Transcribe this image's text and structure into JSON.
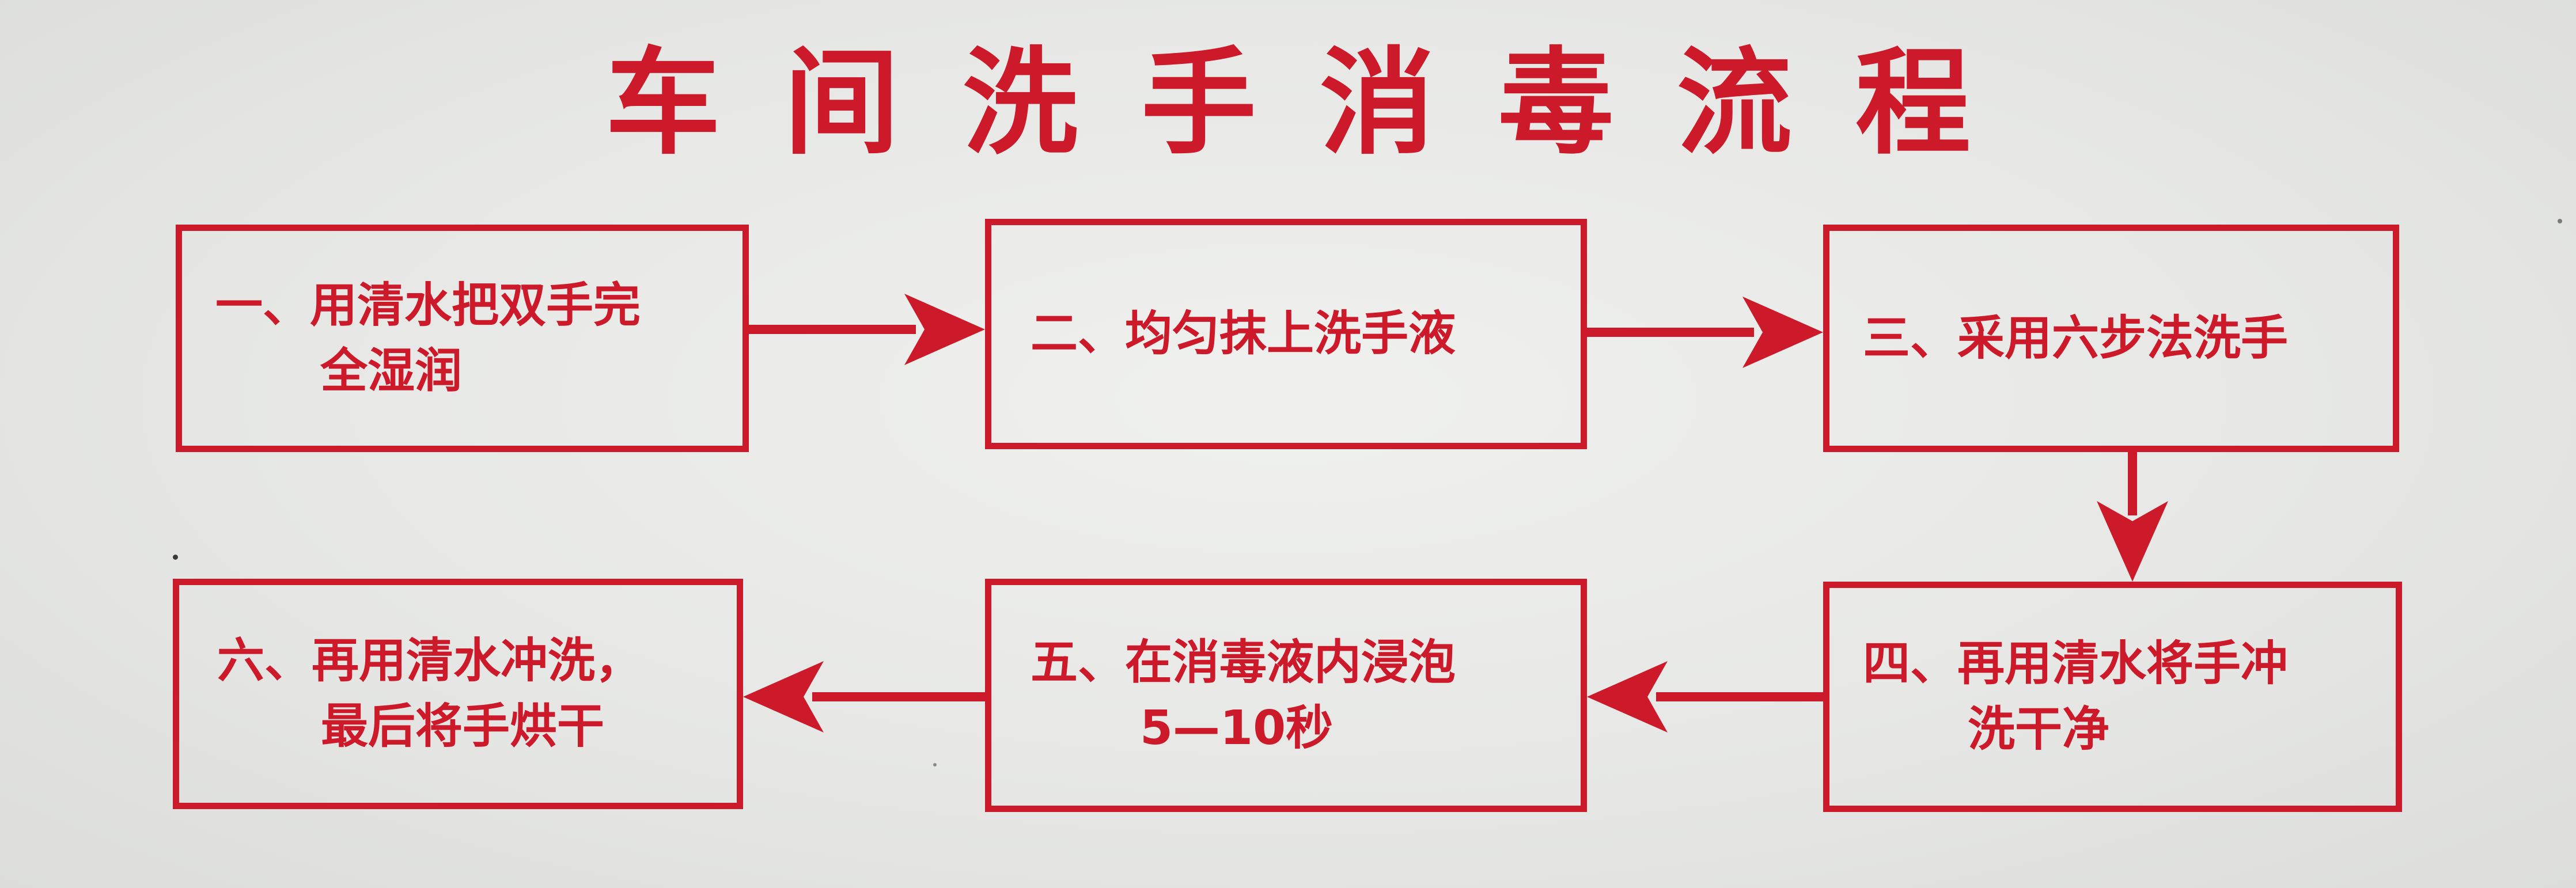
{
  "title": "车间洗手消毒流程",
  "steps": [
    {
      "line1": "一、用清水把双手完",
      "line2": "全湿润"
    },
    {
      "line1": "二、均匀抹上洗手液",
      "line2": ""
    },
    {
      "line1": "三、采用六步法洗手",
      "line2": ""
    },
    {
      "line1": "四、再用清水将手冲",
      "line2": "洗干净"
    },
    {
      "line1": "五、在消毒液内浸泡",
      "line2": "5—10秒"
    },
    {
      "line1": "六、再用清水冲洗，",
      "line2": "最后将手烘干"
    }
  ],
  "colors": {
    "accent": "#cc1a2a",
    "background": "#e9eae8"
  }
}
